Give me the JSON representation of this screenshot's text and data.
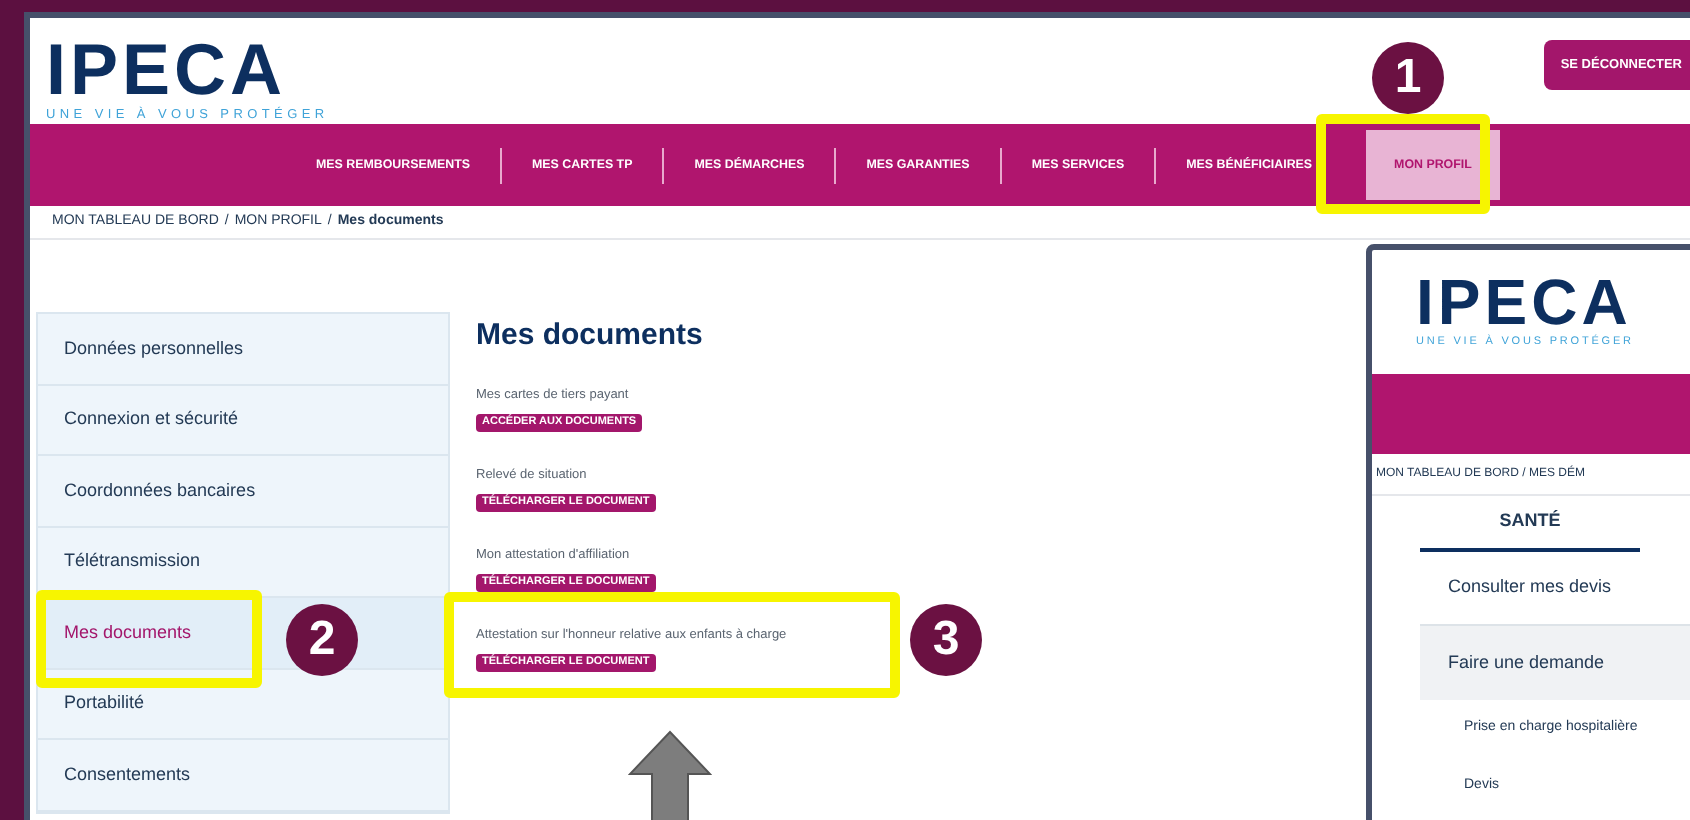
{
  "main_window": {
    "logo": {
      "name": "IPECA",
      "tagline": "UNE VIE À VOUS PROTÉGER"
    },
    "logout_button": "SE DÉCONNECTER",
    "nav": [
      {
        "label": "MES REMBOURSEMENTS",
        "selected": false
      },
      {
        "label": "MES CARTES TP",
        "selected": false
      },
      {
        "label": "MES DÉMARCHES",
        "selected": false
      },
      {
        "label": "MES GARANTIES",
        "selected": false
      },
      {
        "label": "MES SERVICES",
        "selected": false
      },
      {
        "label": "MES BÉNÉFICIAIRES",
        "selected": false
      },
      {
        "label": "MON PROFIL",
        "selected": true
      }
    ],
    "breadcrumb": [
      "MON TABLEAU DE BORD",
      "MON PROFIL",
      "Mes documents"
    ],
    "breadcrumb_separator": "/",
    "sidebar": [
      {
        "label": "Données personnelles",
        "selected": false
      },
      {
        "label": "Connexion et sécurité",
        "selected": false
      },
      {
        "label": "Coordonnées bancaires",
        "selected": false
      },
      {
        "label": "Télétransmission",
        "selected": false
      },
      {
        "label": "Mes documents",
        "selected": true
      },
      {
        "label": "Portabilité",
        "selected": false
      },
      {
        "label": "Consentements",
        "selected": false
      }
    ],
    "title": "Mes documents",
    "documents": [
      {
        "label": "Mes cartes de tiers payant",
        "button": "ACCÉDER AUX DOCUMENTS"
      },
      {
        "label": "Relevé de situation",
        "button": "TÉLÉCHARGER LE DOCUMENT"
      },
      {
        "label": "Mon attestation d'affiliation",
        "button": "TÉLÉCHARGER LE DOCUMENT"
      },
      {
        "label": "Attestation sur l'honneur relative aux enfants à charge",
        "button": "TÉLÉCHARGER LE DOCUMENT"
      }
    ]
  },
  "second_window": {
    "logo": {
      "name": "IPECA",
      "tagline": "UNE VIE À VOUS PROTÉGER"
    },
    "breadcrumb": "MON TABLEAU DE BORD / MES DÉM",
    "tabs": [
      {
        "label": "SANTÉ",
        "selected": true
      }
    ],
    "menu": [
      {
        "label": "Consulter mes devis",
        "kind": "row"
      },
      {
        "label": "Faire une demande",
        "kind": "group"
      },
      {
        "label": "Prise en charge hospitalière",
        "kind": "subitem"
      },
      {
        "label": "Devis",
        "kind": "subitem"
      }
    ]
  },
  "markers": [
    "1",
    "2",
    "3"
  ]
}
